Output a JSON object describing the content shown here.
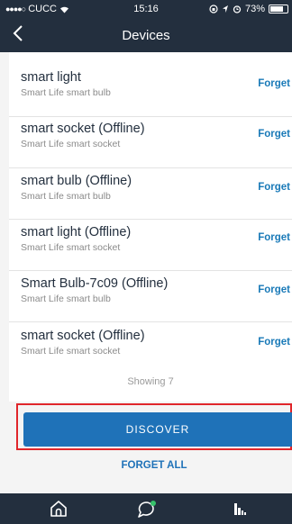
{
  "status_bar": {
    "carrier": "CUCC",
    "signal": "●●●●○",
    "time": "15:16",
    "battery": "73%"
  },
  "nav": {
    "title": "Devices"
  },
  "devices": [
    {
      "name": "smart light",
      "type": "Smart Life smart bulb",
      "action": "Forget"
    },
    {
      "name": "smart socket (Offline)",
      "type": "Smart Life smart socket",
      "action": "Forget"
    },
    {
      "name": "smart bulb (Offline)",
      "type": "Smart Life smart bulb",
      "action": "Forget"
    },
    {
      "name": "smart light (Offline)",
      "type": "Smart Life smart socket",
      "action": "Forget"
    },
    {
      "name": "Smart Bulb-7c09 (Offline)",
      "type": "Smart Life smart bulb",
      "action": "Forget"
    },
    {
      "name": "smart socket (Offline)",
      "type": "Smart Life smart socket",
      "action": "Forget"
    }
  ],
  "footer": {
    "showing": "Showing 7",
    "discover_label": "DISCOVER",
    "forget_all_label": "FORGET ALL"
  },
  "tab_bar": {
    "tabs": [
      {
        "icon": "home-icon"
      },
      {
        "icon": "chat-icon"
      },
      {
        "icon": "activity-icon"
      }
    ]
  },
  "colors": {
    "header": "#232f3e",
    "accent": "#1f72b8",
    "highlight": "#e0262b",
    "notification_dot": "#36c26b"
  }
}
